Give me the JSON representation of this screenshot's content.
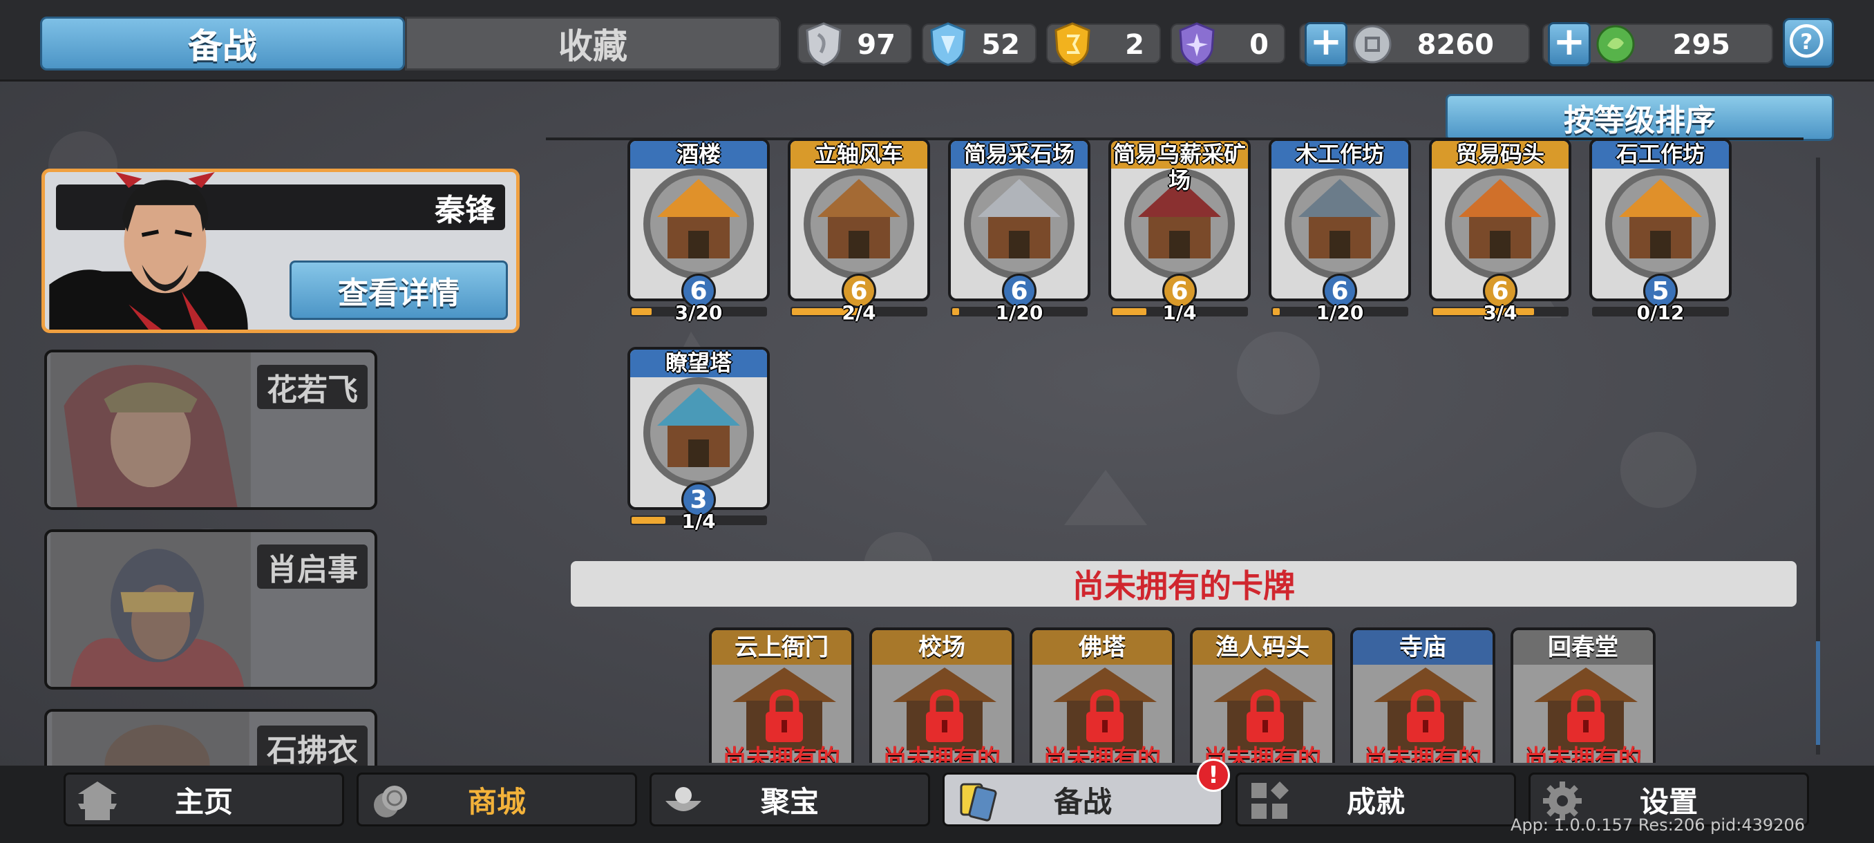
{
  "tabs": {
    "active": "备战",
    "inactive": "收藏"
  },
  "resources": [
    {
      "icon": "silver-shield-icon",
      "value": "97",
      "color": "#c9ccd2"
    },
    {
      "icon": "blue-shield-icon",
      "value": "52",
      "color": "#7cc3ef"
    },
    {
      "icon": "gold-shield-icon",
      "value": "2",
      "color": "#f2b21e"
    },
    {
      "icon": "purple-shield-icon",
      "value": "0",
      "color": "#8a6fd1"
    },
    {
      "icon": "silver-coin-icon",
      "value": "8260",
      "color": "#b9bec4"
    },
    {
      "icon": "jade-coin-icon",
      "value": "295",
      "color": "#57b34a"
    }
  ],
  "sort_label": "按等级排序",
  "heroes": {
    "selected": {
      "name": "秦锋",
      "detail_label": "查看详情"
    },
    "others": [
      {
        "name": "花若飞"
      },
      {
        "name": "肖启事"
      },
      {
        "name": "石拂衣"
      }
    ]
  },
  "owned_cards": [
    {
      "title": "酒楼",
      "level": "6",
      "count": "3/20",
      "progress": 0.15,
      "header": "#3a72b8",
      "level_color": "#3a72b8"
    },
    {
      "title": "立轴风车",
      "level": "6",
      "count": "2/4",
      "progress": 0.5,
      "header": "#d99a2a",
      "level_color": "#d99a2a"
    },
    {
      "title": "简易采石场",
      "level": "6",
      "count": "1/20",
      "progress": 0.05,
      "header": "#3a72b8",
      "level_color": "#3a72b8"
    },
    {
      "title": "简易乌薪采矿场",
      "level": "6",
      "count": "1/4",
      "progress": 0.25,
      "header": "#d99a2a",
      "level_color": "#d99a2a"
    },
    {
      "title": "木工作坊",
      "level": "6",
      "count": "1/20",
      "progress": 0.05,
      "header": "#3a72b8",
      "level_color": "#3a72b8"
    },
    {
      "title": "贸易码头",
      "level": "6",
      "count": "3/4",
      "progress": 0.75,
      "header": "#d99a2a",
      "level_color": "#d99a2a"
    },
    {
      "title": "石工作坊",
      "level": "5",
      "count": "0/12",
      "progress": 0,
      "header": "#3a72b8",
      "level_color": "#3a72b8"
    },
    {
      "title": "瞭望塔",
      "level": "3",
      "count": "1/4",
      "progress": 0.25,
      "header": "#3a72b8",
      "level_color": "#3a72b8"
    }
  ],
  "unowned_banner": "尚未拥有的卡牌",
  "unowned_cards": [
    {
      "title": "云上衙门",
      "lock_text": "尚未拥有的",
      "header": "#a8782a"
    },
    {
      "title": "校场",
      "lock_text": "尚未拥有的",
      "header": "#a8782a"
    },
    {
      "title": "佛塔",
      "lock_text": "尚未拥有的",
      "header": "#a8782a"
    },
    {
      "title": "渔人码头",
      "lock_text": "尚未拥有的",
      "header": "#a8782a"
    },
    {
      "title": "寺庙",
      "lock_text": "尚未拥有的",
      "header": "#3a64a0"
    },
    {
      "title": "回春堂",
      "lock_text": "尚未拥有的",
      "header": "#6e6e6e"
    }
  ],
  "nav": [
    {
      "label": "主页",
      "icon": "pagoda-icon"
    },
    {
      "label": "商城",
      "icon": "coins-icon",
      "color": "#f3b23a"
    },
    {
      "label": "聚宝",
      "icon": "treasure-bowl-icon"
    },
    {
      "label": "备战",
      "icon": "cards-icon",
      "active": true
    },
    {
      "label": "成就",
      "icon": "achievement-grid-icon"
    },
    {
      "label": "设置",
      "icon": "gear-icon"
    }
  ],
  "nav_badge": "!",
  "version": "App: 1.0.0.157 Res:206 pid:439206"
}
